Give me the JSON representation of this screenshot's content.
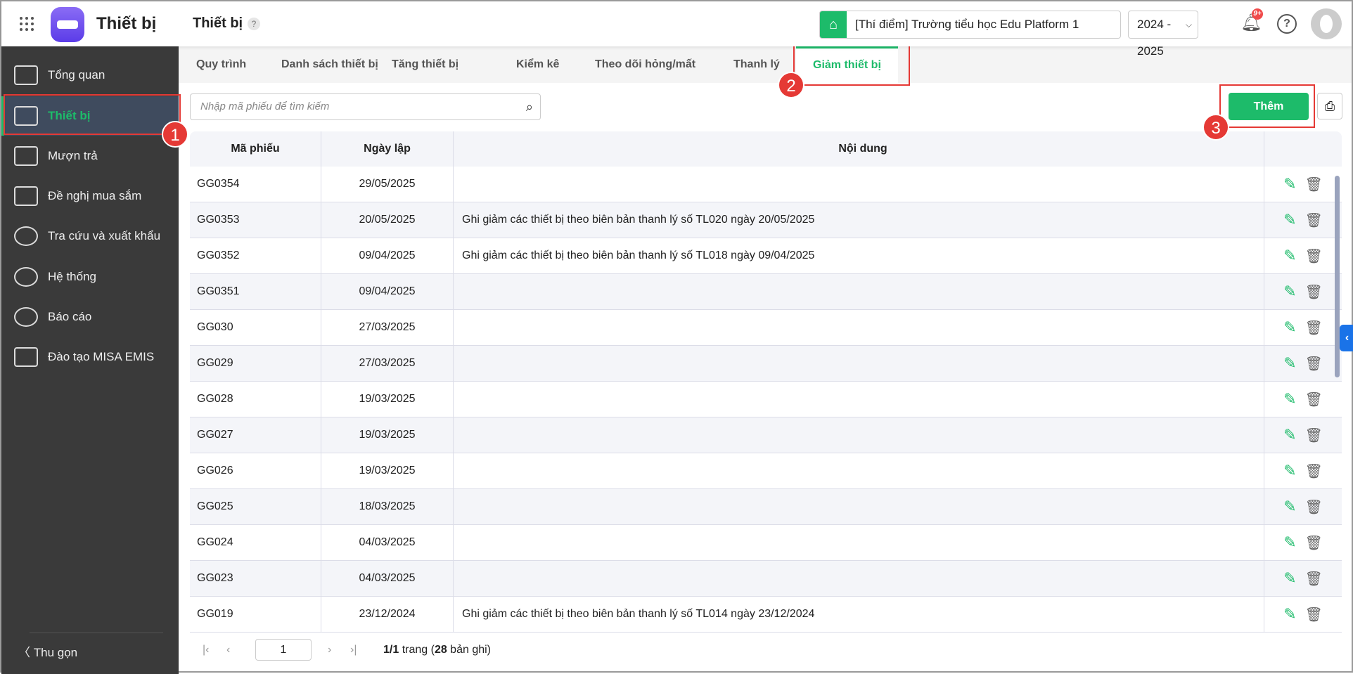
{
  "header": {
    "app_title": "Thiết bị",
    "page_title": "Thiết bị",
    "help": "?",
    "school": "[Thí điểm] Trường tiểu học Edu Platform 1",
    "year": "2024 - 2025",
    "notif_badge": "9+"
  },
  "sidebar": {
    "items": [
      {
        "label": "Tổng quan"
      },
      {
        "label": "Thiết bị"
      },
      {
        "label": "Mượn trả"
      },
      {
        "label": "Đề nghị mua sắm"
      },
      {
        "label": "Tra cứu và xuất khẩu"
      },
      {
        "label": "Hệ thống"
      },
      {
        "label": "Báo cáo"
      },
      {
        "label": "Đào tạo MISA EMIS"
      }
    ],
    "collapse": "Thu gọn"
  },
  "tabs": [
    "Quy trình",
    "Danh sách thiết bị",
    "Tăng thiết bị",
    "Kiểm kê",
    "Theo dõi hỏng/mất",
    "Thanh lý",
    "Giảm thiết bị"
  ],
  "search": {
    "placeholder": "Nhập mã phiếu để tìm kiếm"
  },
  "toolbar": {
    "add": "Thêm"
  },
  "table": {
    "headers": [
      "Mã phiếu",
      "Ngày lập",
      "Nội dung"
    ],
    "rows": [
      [
        "GG0354",
        "29/05/2025",
        ""
      ],
      [
        "GG0353",
        "20/05/2025",
        "Ghi giảm các thiết bị theo biên bản thanh lý số TL020 ngày 20/05/2025"
      ],
      [
        "GG0352",
        "09/04/2025",
        "Ghi giảm các thiết bị theo biên bản thanh lý số TL018 ngày 09/04/2025"
      ],
      [
        "GG0351",
        "09/04/2025",
        ""
      ],
      [
        "GG030",
        "27/03/2025",
        ""
      ],
      [
        "GG029",
        "27/03/2025",
        ""
      ],
      [
        "GG028",
        "19/03/2025",
        ""
      ],
      [
        "GG027",
        "19/03/2025",
        ""
      ],
      [
        "GG026",
        "19/03/2025",
        ""
      ],
      [
        "GG025",
        "18/03/2025",
        ""
      ],
      [
        "GG024",
        "04/03/2025",
        ""
      ],
      [
        "GG023",
        "04/03/2025",
        ""
      ],
      [
        "GG019",
        "23/12/2024",
        "Ghi giảm các thiết bị theo biên bản thanh lý số TL014 ngày 23/12/2024"
      ]
    ]
  },
  "pagination": {
    "page": "1",
    "pages": "1/1",
    "trang": " trang (",
    "count": "28",
    "records": " bản ghi)"
  },
  "annotations": [
    "1",
    "2",
    "3"
  ]
}
